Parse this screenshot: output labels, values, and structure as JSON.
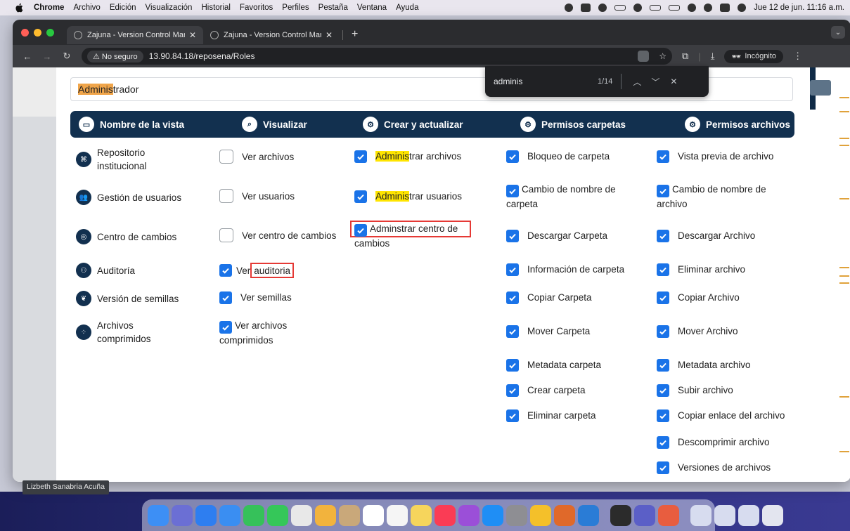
{
  "menubar": {
    "app": "Chrome",
    "items": [
      "Archivo",
      "Edición",
      "Visualización",
      "Historial",
      "Favoritos",
      "Perfiles",
      "Pestaña",
      "Ventana",
      "Ayuda"
    ],
    "clock": "Jue 12 de jun.  11:16 a.m."
  },
  "browser": {
    "tabs": [
      {
        "title": "Zajuna - Version Control Man",
        "active": true
      },
      {
        "title": "Zajuna - Version Control Man",
        "active": false
      }
    ],
    "security": "No seguro",
    "url": "13.90.84.18/reposena/Roles",
    "incognito": "Incógnito"
  },
  "find": {
    "query": "adminis",
    "count": "1/14"
  },
  "role_field": {
    "match": "Adminis",
    "rest": "trador"
  },
  "headers": [
    "Nombre de la vista",
    "Visualizar",
    "Crear y actualizar",
    "Permisos carpetas",
    "Permisos archivos"
  ],
  "rows": [
    {
      "view": {
        "label": "Repositorio institucional",
        "icon": "repository-icon"
      },
      "visualizar": {
        "label": "Ver archivos",
        "checked": false
      },
      "crear": {
        "pre": "",
        "match": "Adminis",
        "post": "trar archivos",
        "checked": true
      },
      "carpetas": {
        "label": "Bloqueo de carpeta",
        "checked": true
      },
      "archivos": {
        "label": "Vista previa de archivo",
        "checked": true
      }
    },
    {
      "view": {
        "label": "Gestión de usuarios",
        "icon": "users-icon"
      },
      "visualizar": {
        "label": "Ver usuarios",
        "checked": false
      },
      "crear": {
        "pre": "",
        "match": "Adminis",
        "post": "trar usuarios",
        "checked": true
      },
      "carpetas": {
        "label": "Cambio de nombre de carpeta",
        "checked": true
      },
      "archivos": {
        "label": "Cambio de nombre de archivo",
        "checked": true
      }
    },
    {
      "view": {
        "label": "Centro de cambios",
        "icon": "changes-icon"
      },
      "visualizar": {
        "label": "Ver centro de cambios",
        "checked": false
      },
      "crear": {
        "pre": "Adminstrar centro de cambios",
        "match": "",
        "post": "",
        "checked": true
      },
      "carpetas": {
        "label": "Descargar Carpeta",
        "checked": true
      },
      "archivos": {
        "label": "Descargar Archivo",
        "checked": true
      }
    },
    {
      "view": {
        "label": "Auditoría",
        "icon": "audit-icon"
      },
      "visualizar": {
        "pre": "Ver ",
        "boxed": "auditoria",
        "checked": true
      },
      "carpetas": {
        "label": "Información de carpeta",
        "checked": true
      },
      "archivos": {
        "label": "Eliminar archivo",
        "checked": true
      }
    },
    {
      "view": {
        "label": "Versión de semillas",
        "icon": "seeds-icon"
      },
      "visualizar": {
        "label": "Ver semillas",
        "checked": true
      },
      "carpetas": {
        "label": "Copiar Carpeta",
        "checked": true
      },
      "archivos": {
        "label": "Copiar Archivo",
        "checked": true
      }
    },
    {
      "view": {
        "label": "Archivos comprimidos",
        "icon": "compressed-icon"
      },
      "visualizar": {
        "label": "Ver archivos comprimidos",
        "checked": true
      },
      "carpetas": {
        "label": "Mover Carpeta",
        "checked": true
      },
      "archivos": {
        "label": "Mover Archivo",
        "checked": true
      }
    }
  ],
  "extra_carpetas": [
    "Metadata carpeta",
    "Crear carpeta",
    "Eliminar carpeta"
  ],
  "extra_archivos": [
    "Metadata archivo",
    "Subir archivo",
    "Copiar enlace del archivo",
    "Descomprimir archivo",
    "Versiones de archivos"
  ],
  "status_text": "Lizbeth Sanabria Acuña",
  "colors": {
    "header_bg": "#12304f",
    "checkbox": "#1a73e8",
    "find_match_current": "#f0a54a",
    "find_match": "#ffe500",
    "annotation": "#e53935"
  }
}
